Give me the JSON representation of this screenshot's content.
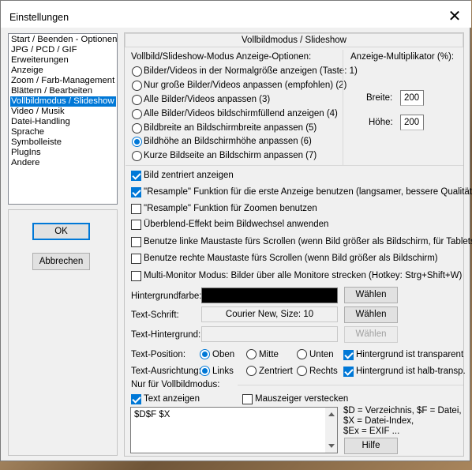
{
  "window": {
    "title": "Einstellungen",
    "close_glyph": "✕"
  },
  "categories": [
    {
      "label": "Start / Beenden - Optionen",
      "selected": false
    },
    {
      "label": "JPG / PCD / GIF",
      "selected": false
    },
    {
      "label": "Erweiterungen",
      "selected": false
    },
    {
      "label": "Anzeige",
      "selected": false
    },
    {
      "label": "Zoom / Farb-Management",
      "selected": false
    },
    {
      "label": "Blättern / Bearbeiten",
      "selected": false
    },
    {
      "label": "Vollbildmodus / Slideshow",
      "selected": true
    },
    {
      "label": "Video / Musik",
      "selected": false
    },
    {
      "label": "Datei-Handling",
      "selected": false
    },
    {
      "label": "Sprache",
      "selected": false
    },
    {
      "label": "Symbolleiste",
      "selected": false
    },
    {
      "label": "PlugIns",
      "selected": false
    },
    {
      "label": "Andere",
      "selected": false
    }
  ],
  "buttons": {
    "ok": "OK",
    "cancel": "Abbrechen"
  },
  "panel": {
    "heading": "Vollbildmodus / Slideshow",
    "mode_group_label": "Vollbild/Slideshow-Modus Anzeige-Optionen:",
    "mode_options": [
      {
        "label": "Bilder/Videos in der Normalgröße anzeigen (Taste: 1)",
        "checked": false
      },
      {
        "label": "Nur große Bilder/Videos anpassen (empfohlen) (2)",
        "checked": false
      },
      {
        "label": "Alle Bilder/Videos anpassen (3)",
        "checked": false
      },
      {
        "label": "Alle Bilder/Videos bildschirmfüllend anzeigen (4)",
        "checked": false
      },
      {
        "label": "Bildbreite an Bildschirmbreite anpassen (5)",
        "checked": false
      },
      {
        "label": "Bildhöhe an Bildschirmhöhe anpassen (6)",
        "checked": true
      },
      {
        "label": "Kurze Bildseite an Bildschirm anpassen (7)",
        "checked": false
      }
    ],
    "multiplier": {
      "label": "Anzeige-Multiplikator (%):",
      "width_label": "Breite:",
      "width_value": "200",
      "height_label": "Höhe:",
      "height_value": "200"
    },
    "checkboxes": [
      {
        "label": "Bild zentriert anzeigen",
        "checked": true
      },
      {
        "label": "\"Resample\" Funktion für die erste Anzeige benutzen (langsamer, bessere Qualität)",
        "checked": true
      },
      {
        "label": "\"Resample\" Funktion für Zoomen benutzen",
        "checked": false
      },
      {
        "label": "Überblend-Effekt beim Bildwechsel anwenden",
        "checked": false
      },
      {
        "label": "Benutze linke Maustaste fürs Scrollen (wenn Bild größer als Bildschirm, für Tablets)",
        "checked": false
      },
      {
        "label": "Benutze rechte Maustaste fürs Scrollen (wenn Bild größer als Bildschirm)",
        "checked": false
      },
      {
        "label": "Multi-Monitor Modus: Bilder über alle Monitore strecken (Hotkey: Strg+Shift+W)",
        "checked": false
      }
    ],
    "background": {
      "label": "Hintergrundfarbe:",
      "color": "#000000",
      "button": "Wählen"
    },
    "font": {
      "label": "Text-Schrift:",
      "value": "Courier New, Size: 10",
      "button": "Wählen"
    },
    "text_bg": {
      "label": "Text-Hintergrund:",
      "value": "",
      "button": "Wählen"
    },
    "position": {
      "label": "Text-Position:",
      "options": [
        {
          "label": "Oben",
          "checked": true
        },
        {
          "label": "Mitte",
          "checked": false
        },
        {
          "label": "Unten",
          "checked": false
        }
      ],
      "extra_label": "Hintergrund ist transparent",
      "extra_checked": true
    },
    "alignment": {
      "label": "Text-Ausrichtung:",
      "options": [
        {
          "label": "Links",
          "checked": true
        },
        {
          "label": "Zentriert",
          "checked": false
        },
        {
          "label": "Rechts",
          "checked": false
        }
      ],
      "extra_label": "Hintergrund ist halb-transp.",
      "extra_checked": true
    },
    "fullscreen_only": {
      "label": "Nur für Vollbildmodus:",
      "show_text_label": "Text anzeigen",
      "show_text_checked": true,
      "hide_cursor_label": "Mauszeiger verstecken",
      "hide_cursor_checked": false,
      "text_value": "$D$F $X",
      "help_lines": [
        "$D = Verzeichnis, $F = Datei,",
        "$X = Datei-Index,",
        "$Ex = EXIF ..."
      ],
      "help_button": "Hilfe"
    }
  },
  "colors": {
    "accent": "#0078d7",
    "dialog_bg": "#f0f0f0"
  }
}
